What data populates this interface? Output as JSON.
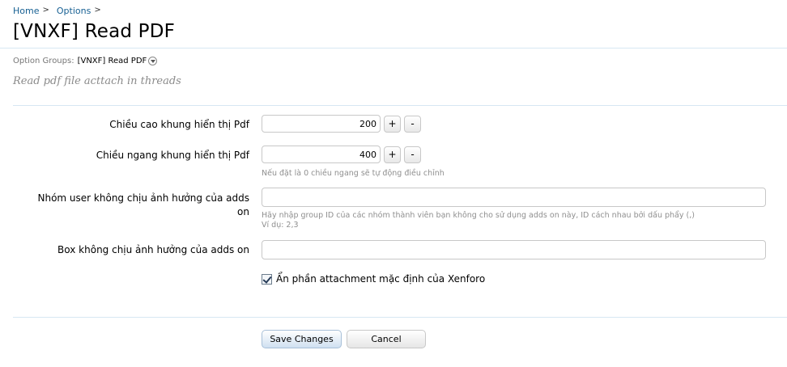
{
  "breadcrumb": [
    {
      "label": "Home",
      "sep": ">"
    },
    {
      "label": "Options",
      "sep": ">"
    }
  ],
  "page_title": "[VNXF] Read PDF",
  "option_groups": {
    "label": "Option Groups:",
    "value": "[VNXF] Read PDF",
    "icon": "chevron-down-circle-icon"
  },
  "description": "Read pdf file acttach in threads",
  "fields": {
    "height": {
      "label": "Chiều cao khung hiển thị Pdf",
      "value": "200",
      "plus": "+",
      "minus": "-"
    },
    "width": {
      "label": "Chiều ngang khung hiển thị Pdf",
      "value": "400",
      "plus": "+",
      "minus": "-",
      "hint": "Nếu đặt là 0 chiều ngang sẽ tự động điều chỉnh"
    },
    "excluded_groups": {
      "label_line1": "Nhóm user không chịu ảnh hưởng của adds",
      "label_line2": "on",
      "value": "",
      "hint_line1": "Hãy nhập group ID của các nhóm thành viên bạn không cho sử dụng adds on này, ID cách nhau bởi dấu phẩy (,)",
      "hint_line2": "Ví dụ: 2,3"
    },
    "excluded_boxes": {
      "label": "Box không chịu ảnh hưởng của adds on",
      "value": ""
    },
    "hide_attachment": {
      "label": "Ẩn phần attachment mặc định của Xenforo",
      "checked": true
    }
  },
  "buttons": {
    "save": "Save Changes",
    "cancel": "Cancel"
  },
  "colors": {
    "link": "#176093",
    "divider": "#d7e7f3",
    "hint": "#8f8f8f"
  }
}
